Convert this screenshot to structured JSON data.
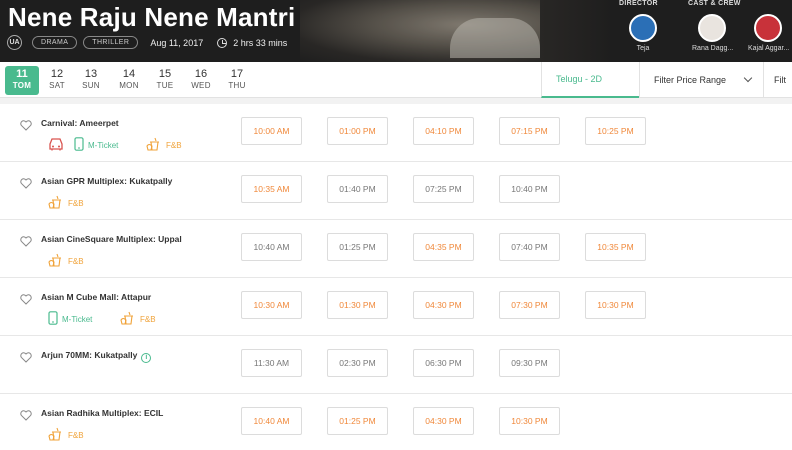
{
  "movie": {
    "title": "Nene Raju Nene Mantri",
    "certificate": "UA",
    "genres": [
      "DRAMA",
      "THRILLER"
    ],
    "release_date": "Aug 11, 2017",
    "duration": "2 hrs 33 mins"
  },
  "crew": {
    "director_label": "DIRECTOR",
    "cast_label": "CAST & CREW",
    "people": [
      {
        "name": "Teja",
        "color": "#2b6fb6"
      },
      {
        "name": "Rana Dagg...",
        "color": "#e9e4df"
      },
      {
        "name": "Kajal Aggar...",
        "color": "#c8323a"
      }
    ]
  },
  "dates": [
    {
      "day": "11",
      "weekday": "TOM",
      "active": true
    },
    {
      "day": "12",
      "weekday": "SAT"
    },
    {
      "day": "13",
      "weekday": "SUN"
    },
    {
      "day": "14",
      "weekday": "MON"
    },
    {
      "day": "15",
      "weekday": "TUE"
    },
    {
      "day": "16",
      "weekday": "WED"
    },
    {
      "day": "17",
      "weekday": "THU"
    }
  ],
  "filters": {
    "language": "Telugu - 2D",
    "price": "Filter Price Range",
    "extra": "Filt"
  },
  "colors": {
    "accent": "#49ba8e",
    "available": "#f0883a",
    "amenity": "#f0a33a"
  },
  "venues": [
    {
      "name": "Carnival: Ameerpet",
      "amenities": [
        {
          "icon": "parking-car-icon",
          "label": ""
        },
        {
          "icon": "mobile-ticket-icon",
          "label": "M-Ticket"
        },
        {
          "icon": "food-beverage-icon",
          "label": "F&B"
        }
      ],
      "times": [
        {
          "t": "10:00 AM",
          "avail": true
        },
        {
          "t": "01:00 PM",
          "avail": true
        },
        {
          "t": "04:10 PM",
          "avail": true
        },
        {
          "t": "07:15 PM",
          "avail": true
        },
        {
          "t": "10:25 PM",
          "avail": true
        }
      ]
    },
    {
      "name": "Asian GPR Multiplex: Kukatpally",
      "amenities": [
        {
          "icon": "food-beverage-icon",
          "label": "F&B"
        }
      ],
      "times": [
        {
          "t": "10:35 AM",
          "avail": true
        },
        {
          "t": "01:40 PM",
          "avail": false
        },
        {
          "t": "07:25 PM",
          "avail": false
        },
        {
          "t": "10:40 PM",
          "avail": false
        }
      ]
    },
    {
      "name": "Asian CineSquare Multiplex: Uppal",
      "amenities": [
        {
          "icon": "food-beverage-icon",
          "label": "F&B"
        }
      ],
      "times": [
        {
          "t": "10:40 AM",
          "avail": false
        },
        {
          "t": "01:25 PM",
          "avail": false
        },
        {
          "t": "04:35 PM",
          "avail": true
        },
        {
          "t": "07:40 PM",
          "avail": false
        },
        {
          "t": "10:35 PM",
          "avail": true
        }
      ]
    },
    {
      "name": "Asian M Cube Mall: Attapur",
      "amenities": [
        {
          "icon": "mobile-ticket-icon",
          "label": "M-Ticket"
        },
        {
          "icon": "food-beverage-icon",
          "label": "F&B"
        }
      ],
      "times": [
        {
          "t": "10:30 AM",
          "avail": true
        },
        {
          "t": "01:30 PM",
          "avail": true
        },
        {
          "t": "04:30 PM",
          "avail": true
        },
        {
          "t": "07:30 PM",
          "avail": true
        },
        {
          "t": "10:30 PM",
          "avail": true
        }
      ]
    },
    {
      "name": "Arjun 70MM: Kukatpally",
      "info": true,
      "amenities": [],
      "times": [
        {
          "t": "11:30 AM",
          "avail": false
        },
        {
          "t": "02:30 PM",
          "avail": false
        },
        {
          "t": "06:30 PM",
          "avail": false
        },
        {
          "t": "09:30 PM",
          "avail": false
        }
      ]
    },
    {
      "name": "Asian Radhika Multiplex: ECIL",
      "amenities": [
        {
          "icon": "food-beverage-icon",
          "label": "F&B"
        }
      ],
      "times": [
        {
          "t": "10:40 AM",
          "avail": true
        },
        {
          "t": "01:25 PM",
          "avail": true
        },
        {
          "t": "04:30 PM",
          "avail": true
        },
        {
          "t": "10:30 PM",
          "avail": true
        }
      ]
    }
  ]
}
